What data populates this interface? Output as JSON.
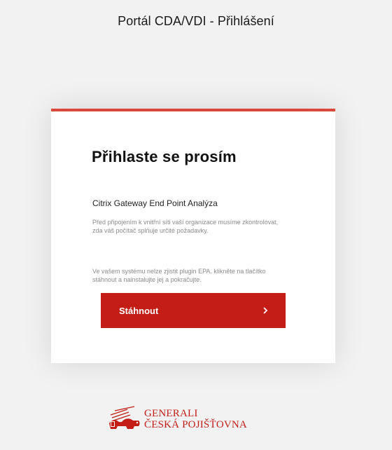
{
  "header": {
    "title": "Portál CDA/VDI - Přihlášení"
  },
  "card": {
    "heading": "Přihlaste se prosím",
    "section_title": "Citrix Gateway End Point Analýza",
    "section_desc": "Před připojením k vnitřní síti vaší organizace musíme zkontrolovat, zda váš počítač splňuje určité požadavky.",
    "plugin_note": "Ve vašem systému nelze zjistit plugin EPA. klikněte na tlačítko stáhnout a nainstalujte jej a pokračujte.",
    "download_button": {
      "label": "Stáhnout",
      "icon": "chevron-right-icon"
    }
  },
  "footer": {
    "logo_icon": "generali-lion-icon",
    "logo_line1": "GENERALI",
    "logo_line2": "ČESKÁ POJIŠŤOVNA"
  },
  "colors": {
    "accent": "#d9473d",
    "button": "#c41d16",
    "background": "#f2f2f2"
  }
}
